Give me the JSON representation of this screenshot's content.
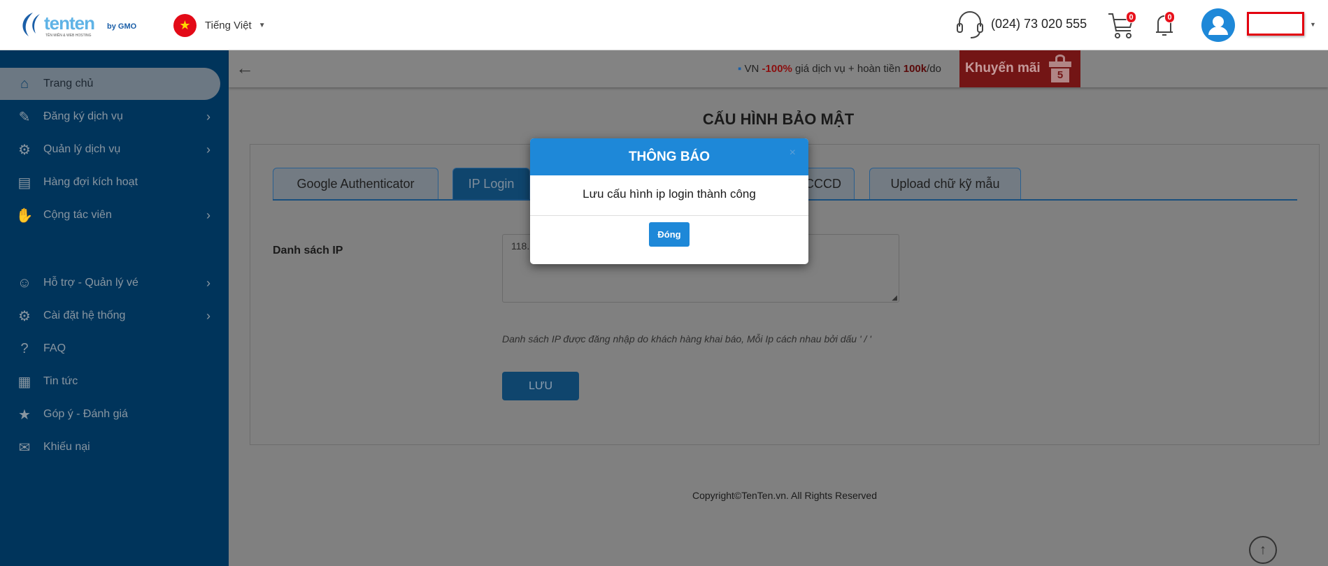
{
  "header": {
    "logo_text": "tenten",
    "logo_sub": "TÊN MIỀN & WEB HOSTING",
    "logo_by": "by GMO",
    "language": "Tiếng Việt",
    "phone": "(024) 73 020 555",
    "cart_count": "0",
    "notification_count": "0"
  },
  "sidebar": {
    "items": [
      {
        "label": "Trang chủ",
        "icon": "home-icon",
        "active": true
      },
      {
        "label": "Đăng ký dịch vụ",
        "icon": "pencil-icon",
        "chevron": true
      },
      {
        "label": "Quản lý dịch vụ",
        "icon": "gear-icon",
        "chevron": true
      },
      {
        "label": "Hàng đợi kích hoạt",
        "icon": "queue-clock-icon"
      },
      {
        "label": "Cộng tác viên",
        "icon": "handshake-icon",
        "chevron": true
      },
      {
        "label": "Hỗ trợ - Quản lý vé",
        "icon": "support-agent-icon",
        "chevron": true
      },
      {
        "label": "Cài đặt hệ thống",
        "icon": "settings-wrench-icon",
        "chevron": true
      },
      {
        "label": "FAQ",
        "icon": "faq-icon"
      },
      {
        "label": "Tin tức",
        "icon": "news-icon"
      },
      {
        "label": "Góp ý - Đánh giá",
        "icon": "rating-thumb-icon"
      },
      {
        "label": "Khiếu nại",
        "icon": "complaint-icon"
      }
    ]
  },
  "promo": {
    "prefix": "VN ",
    "discount": "-100%",
    "middle": " giá dịch vụ + hoàn tiền ",
    "refund": "100k",
    "suffix": "/do",
    "button": "Khuyến mãi",
    "gift_number": "5"
  },
  "page": {
    "title": "CẤU HÌNH BẢO MẬT",
    "tabs": [
      {
        "label": "Google Authenticator"
      },
      {
        "label": "IP Login",
        "active": true
      },
      {
        "label": "CCCD"
      },
      {
        "label": "Upload chữ kỹ mẫu"
      }
    ],
    "ip_label": "Danh sách IP",
    "ip_value": "118.",
    "hint": "Danh sách IP được đăng nhập do khách hàng khai báo, Mỗi Ip cách nhau bởi dấu ' / '",
    "save": "LƯU"
  },
  "footer": {
    "copyright": "Copyright©TenTen.vn. All Rights Reserved"
  },
  "modal": {
    "title": "THÔNG BÁO",
    "message": "Lưu cấu hình ip login thành công",
    "close_button": "Đóng",
    "close_icon": "×"
  },
  "colors": {
    "sidebar": "#00345b",
    "modal_header": "#1e88d8",
    "promo": "#731515",
    "active_tab": "#0f456d"
  }
}
